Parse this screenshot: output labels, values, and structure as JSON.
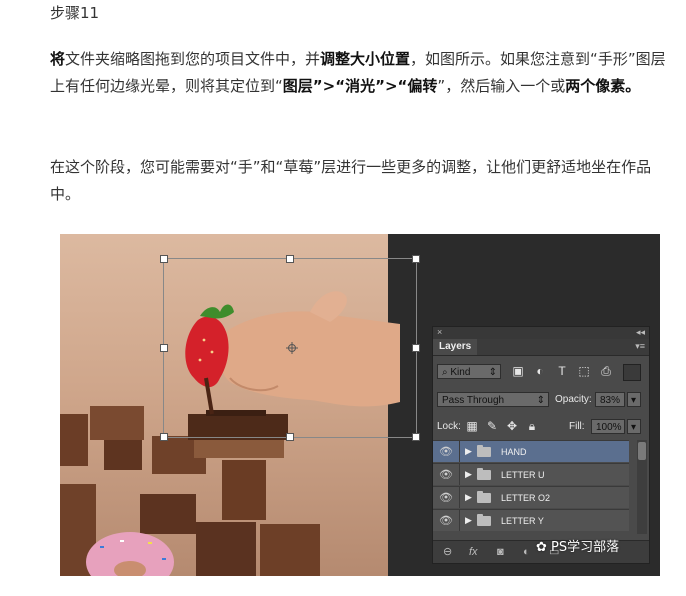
{
  "step_title": "步骤11",
  "paragraph1": {
    "t1": "将",
    "t2": "文件夹缩略图拖到您的项目文件中，并",
    "t3": "调整大小位置",
    "t4": "，如图所示。如果您注意到“手形”图层上有任何边缘光晕，则将其定位到“",
    "t5": "图层",
    "t6": "”>“",
    "t7": "消光",
    "t8": "”>“",
    "t9": "偏转",
    "t10": "”，然后输入一个或",
    "t11": "两个像素。"
  },
  "paragraph2": "在这个阶段，您可能需要对“手”和“草莓”层进行一些更多的调整，让他们更舒适地坐在作品中。",
  "layers_panel": {
    "close_glyph": "×",
    "collapse_glyph": "◂◂",
    "tab_label": "Layers",
    "menu_glyph": "▾≡",
    "filter_label": "Kind",
    "blend_mode": "Pass Through",
    "opacity_label": "Opacity:",
    "opacity_value": "83%",
    "lock_label": "Lock:",
    "fill_label": "Fill:",
    "fill_value": "100%",
    "layers": [
      {
        "name": "HAND",
        "selected": true
      },
      {
        "name": "LETTER U",
        "selected": false
      },
      {
        "name": "LETTER O2",
        "selected": false
      },
      {
        "name": "LETTER Y",
        "selected": false
      }
    ],
    "bottom_fx": "fx"
  },
  "watermark": "PS学习部落",
  "colors": {
    "panel_bg": "#4a4a4a",
    "selected_layer": "#5b6f8f",
    "photo_bg": "#d8b49b",
    "strawberry": "#d4212a"
  }
}
